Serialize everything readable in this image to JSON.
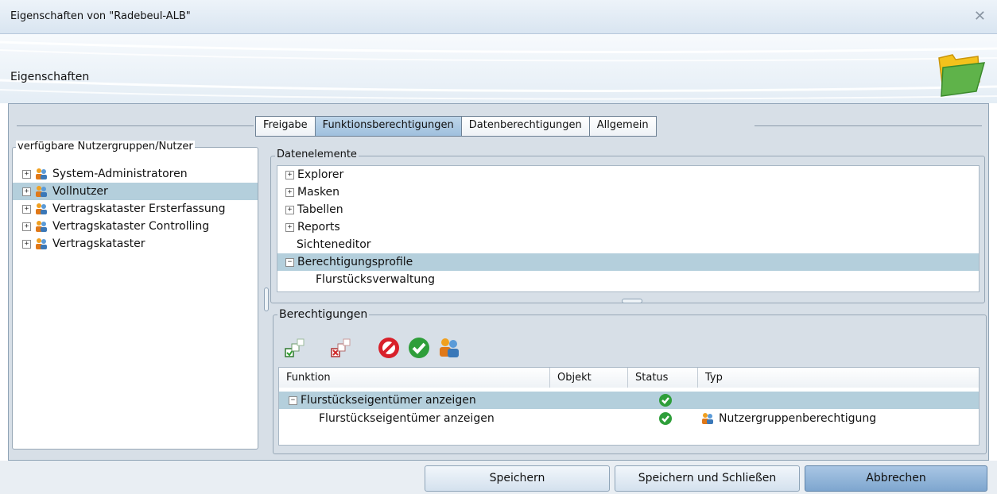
{
  "window": {
    "title": "Eigenschaften von \"Radebeul-ALB\"",
    "close_icon": "close-icon"
  },
  "header": {
    "title": "Eigenschaften",
    "icon": "folder-icon"
  },
  "tabs": [
    {
      "label": "Freigabe",
      "active": false
    },
    {
      "label": "Funktionsberechtigungen",
      "active": true
    },
    {
      "label": "Datenberechtigungen",
      "active": false
    },
    {
      "label": "Allgemein",
      "active": false
    }
  ],
  "user_groups": {
    "legend": "verfügbare Nutzergruppen/Nutzer",
    "items": [
      {
        "label": "System-Administratoren",
        "selected": false
      },
      {
        "label": "Vollnutzer",
        "selected": true
      },
      {
        "label": "Vertragskataster Ersterfassung",
        "selected": false
      },
      {
        "label": "Vertragskataster Controlling",
        "selected": false
      },
      {
        "label": "Vertragskataster",
        "selected": false
      }
    ]
  },
  "data_elements": {
    "legend": "Datenelemente",
    "items": [
      {
        "label": "Explorer",
        "expander": "+",
        "selected": false
      },
      {
        "label": "Masken",
        "expander": "+",
        "selected": false
      },
      {
        "label": "Tabellen",
        "expander": "+",
        "selected": false
      },
      {
        "label": "Reports",
        "expander": "+",
        "selected": false
      },
      {
        "label": "Sichteneditor",
        "expander": "",
        "selected": false
      },
      {
        "label": "Berechtigungsprofile",
        "expander": "−",
        "selected": true
      },
      {
        "label": "Flurstücksverwaltung",
        "expander": "",
        "selected": false,
        "child": true
      }
    ]
  },
  "permissions": {
    "legend": "Berechtigungen",
    "toolbar": [
      "grant-all-icon",
      "revoke-all-icon",
      "deny-icon",
      "allow-icon",
      "user-group-icon"
    ],
    "columns": [
      "Funktion",
      "Objekt",
      "Status",
      "Typ"
    ],
    "rows": [
      {
        "funktion": "Flurstückseigentümer anzeigen",
        "objekt": "",
        "status": "allowed",
        "typ": "",
        "expander": "−",
        "selected": true
      },
      {
        "funktion": "Flurstückseigentümer anzeigen",
        "objekt": "",
        "status": "allowed",
        "typ": "Nutzergruppenberechtigung",
        "expander": "",
        "selected": false
      }
    ]
  },
  "footer": {
    "save": "Speichern",
    "save_close": "Speichern und Schließen",
    "cancel": "Abbrechen"
  },
  "colors": {
    "accent": "#9fc0de",
    "selection": "#b4cfdc",
    "ok_green": "#2e9e3a",
    "deny_red": "#d8202a"
  }
}
